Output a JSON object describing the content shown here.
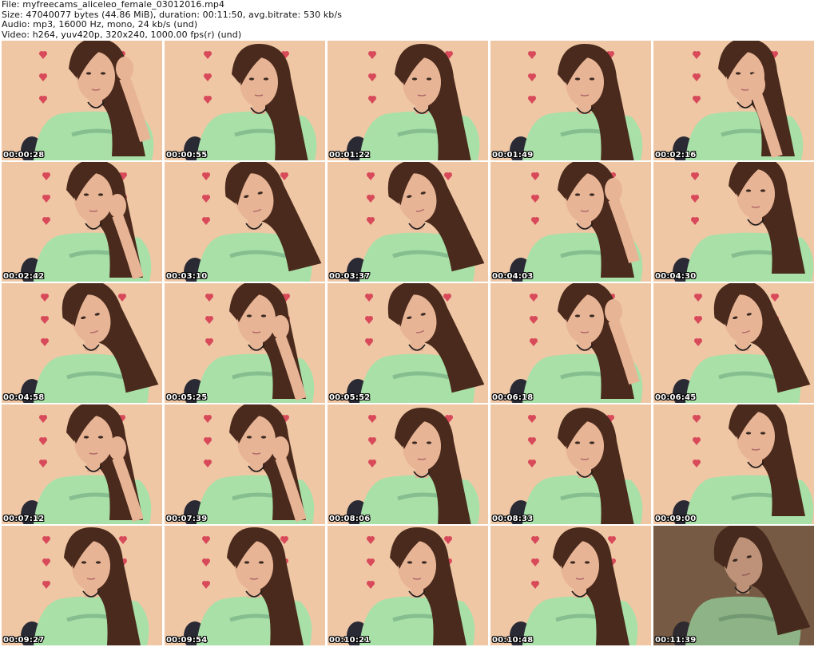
{
  "header": {
    "lines": [
      "File: myfreecams_aliceleo_female_03012016.mp4",
      "Size: 47040077 bytes (44.86 MiB), duration: 00:11:50, avg.bitrate: 530 kb/s",
      "Audio: mp3, 16000 Hz, mono, 24 kb/s (und)",
      "Video: h264, yuv420p, 320x240, 1000.00 fps(r) (und)"
    ]
  },
  "thumbnails": [
    {
      "time": "00:00:28",
      "pose": "hand-hair"
    },
    {
      "time": "00:00:55",
      "pose": "down"
    },
    {
      "time": "00:01:22",
      "pose": "down"
    },
    {
      "time": "00:01:49",
      "pose": "down"
    },
    {
      "time": "00:02:16",
      "pose": "hand-face"
    },
    {
      "time": "00:02:42",
      "pose": "hand-chin"
    },
    {
      "time": "00:03:10",
      "pose": "tilt"
    },
    {
      "time": "00:03:37",
      "pose": "tilt"
    },
    {
      "time": "00:04:03",
      "pose": "hand-hair"
    },
    {
      "time": "00:04:30",
      "pose": "far"
    },
    {
      "time": "00:04:58",
      "pose": "tilt"
    },
    {
      "time": "00:05:25",
      "pose": "hand-chin"
    },
    {
      "time": "00:05:52",
      "pose": "tilt"
    },
    {
      "time": "00:06:18",
      "pose": "hand-hair"
    },
    {
      "time": "00:06:45",
      "pose": "tilt"
    },
    {
      "time": "00:07:12",
      "pose": "hand-chin"
    },
    {
      "time": "00:07:39",
      "pose": "hand-chin"
    },
    {
      "time": "00:08:06",
      "pose": "down"
    },
    {
      "time": "00:08:33",
      "pose": "down"
    },
    {
      "time": "00:09:00",
      "pose": "far"
    },
    {
      "time": "00:09:27",
      "pose": "front"
    },
    {
      "time": "00:09:54",
      "pose": "front"
    },
    {
      "time": "00:10:21",
      "pose": "front"
    },
    {
      "time": "00:10:48",
      "pose": "front"
    },
    {
      "time": "00:11:39",
      "pose": "dark"
    }
  ],
  "colors": {
    "wall": "#efc7a5",
    "wall_dark": "#8a6a50",
    "hair": "#4a2a1c",
    "skin": "#e8b496",
    "shirt": "#a8e0a8",
    "heart": "#d84a5a",
    "chair": "#2a2a35"
  }
}
